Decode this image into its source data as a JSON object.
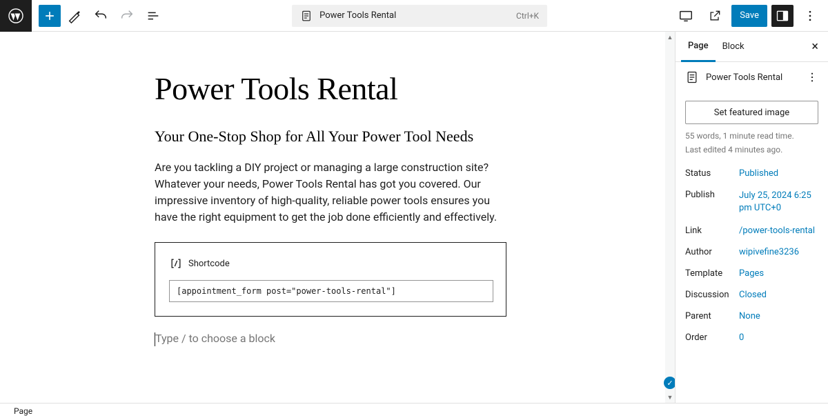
{
  "toolbar": {
    "doc_title": "Power Tools Rental",
    "shortcut": "Ctrl+K",
    "save_label": "Save"
  },
  "editor": {
    "title": "Power Tools Rental",
    "subtitle": "Your One-Stop Shop for All Your Power Tool Needs",
    "paragraph": "Are you tackling a DIY project or managing a large construction site? Whatever your needs, Power Tools Rental has got you covered. Our impressive inventory of high-quality, reliable power tools ensures you have the right equipment to get the job done efficiently and effectively.",
    "shortcode_label": "Shortcode",
    "shortcode_value": "[appointment_form post=\"power-tools-rental\"]",
    "placeholder": "Type / to choose a block"
  },
  "sidebar": {
    "tabs": {
      "page": "Page",
      "block": "Block"
    },
    "page_name": "Power Tools Rental",
    "featured_label": "Set featured image",
    "word_count": "55 words, 1 minute read time.",
    "last_edited": "Last edited 4 minutes ago.",
    "rows": {
      "status_k": "Status",
      "status_v": "Published",
      "publish_k": "Publish",
      "publish_v": "July 25, 2024 6:25 pm UTC+0",
      "link_k": "Link",
      "link_v": "/power-tools-rental",
      "author_k": "Author",
      "author_v": "wipivefine3236",
      "template_k": "Template",
      "template_v": "Pages",
      "discussion_k": "Discussion",
      "discussion_v": "Closed",
      "parent_k": "Parent",
      "parent_v": "None",
      "order_k": "Order",
      "order_v": "0"
    }
  },
  "footer": {
    "breadcrumb": "Page"
  }
}
